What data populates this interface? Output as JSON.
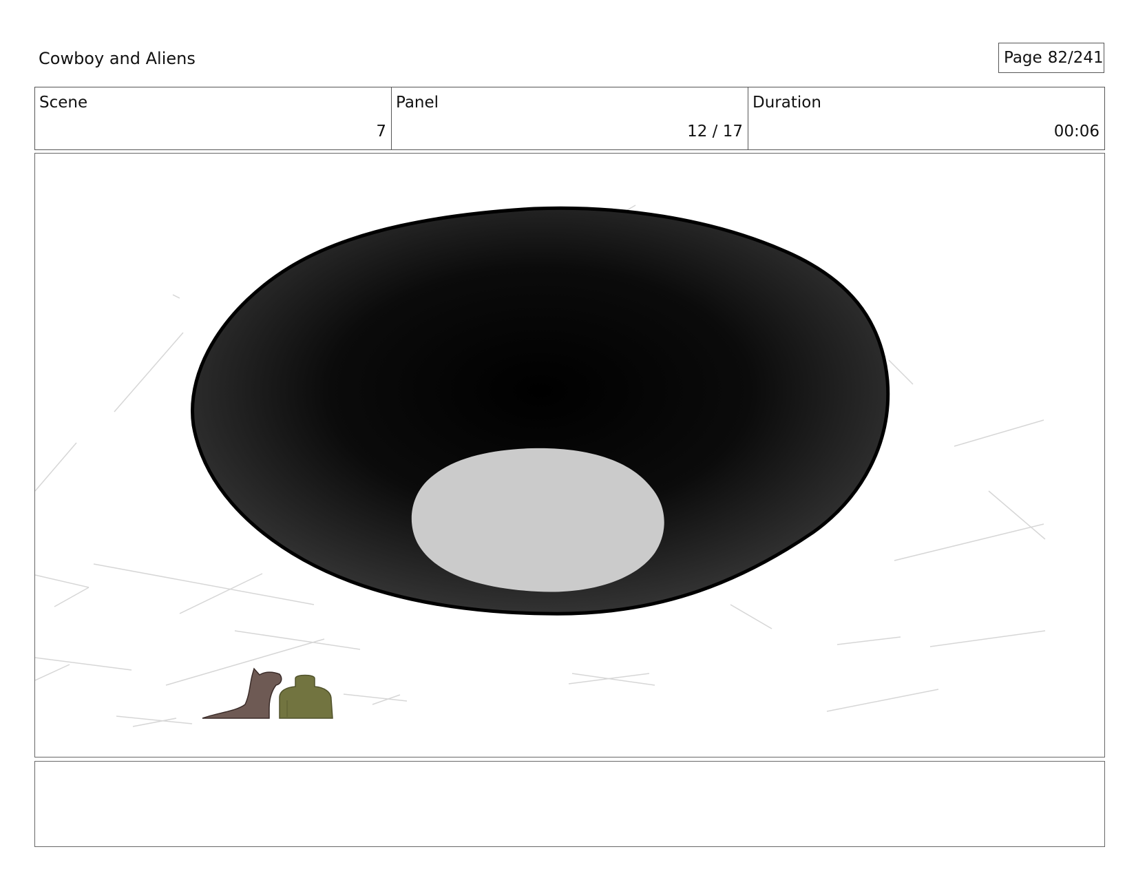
{
  "header": {
    "project_title": "Cowboy and Aliens",
    "page_label": "Page",
    "page_number": "82/241"
  },
  "info": {
    "scene_label": "Scene",
    "scene_value": "7",
    "panel_label": "Panel",
    "panel_value": "12 / 17",
    "duration_label": "Duration",
    "duration_value": "00:06"
  },
  "frame": {
    "description_icons": [
      "ufo-saucer-icon",
      "horse-icon",
      "cowboy-icon"
    ]
  },
  "notes": {
    "text": ""
  },
  "colors": {
    "ufo_body": "#0a0a0a",
    "ufo_light": "#cbcbcb",
    "horse": "#6e5a54",
    "cowboy": "#727440",
    "sketch_lines": "#d4d4d4"
  }
}
